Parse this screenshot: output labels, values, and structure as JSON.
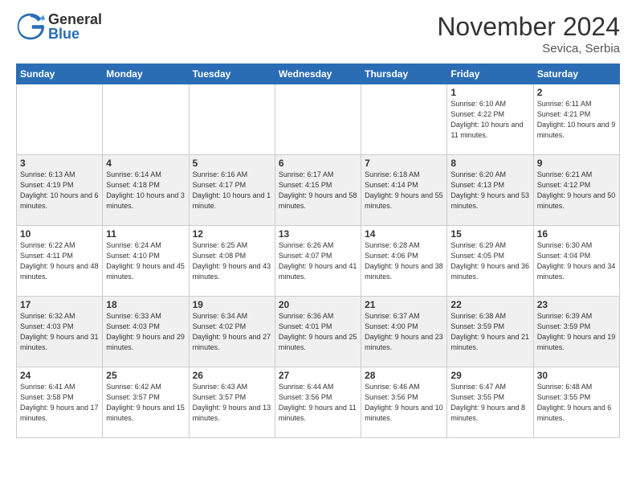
{
  "header": {
    "logo_general": "General",
    "logo_blue": "Blue",
    "month_title": "November 2024",
    "location": "Sevica, Serbia"
  },
  "days_of_week": [
    "Sunday",
    "Monday",
    "Tuesday",
    "Wednesday",
    "Thursday",
    "Friday",
    "Saturday"
  ],
  "weeks": [
    [
      {
        "day": "",
        "info": ""
      },
      {
        "day": "",
        "info": ""
      },
      {
        "day": "",
        "info": ""
      },
      {
        "day": "",
        "info": ""
      },
      {
        "day": "",
        "info": ""
      },
      {
        "day": "1",
        "info": "Sunrise: 6:10 AM\nSunset: 4:22 PM\nDaylight: 10 hours\nand 11 minutes."
      },
      {
        "day": "2",
        "info": "Sunrise: 6:11 AM\nSunset: 4:21 PM\nDaylight: 10 hours\nand 9 minutes."
      }
    ],
    [
      {
        "day": "3",
        "info": "Sunrise: 6:13 AM\nSunset: 4:19 PM\nDaylight: 10 hours\nand 6 minutes."
      },
      {
        "day": "4",
        "info": "Sunrise: 6:14 AM\nSunset: 4:18 PM\nDaylight: 10 hours\nand 3 minutes."
      },
      {
        "day": "5",
        "info": "Sunrise: 6:16 AM\nSunset: 4:17 PM\nDaylight: 10 hours\nand 1 minute."
      },
      {
        "day": "6",
        "info": "Sunrise: 6:17 AM\nSunset: 4:15 PM\nDaylight: 9 hours\nand 58 minutes."
      },
      {
        "day": "7",
        "info": "Sunrise: 6:18 AM\nSunset: 4:14 PM\nDaylight: 9 hours\nand 55 minutes."
      },
      {
        "day": "8",
        "info": "Sunrise: 6:20 AM\nSunset: 4:13 PM\nDaylight: 9 hours\nand 53 minutes."
      },
      {
        "day": "9",
        "info": "Sunrise: 6:21 AM\nSunset: 4:12 PM\nDaylight: 9 hours\nand 50 minutes."
      }
    ],
    [
      {
        "day": "10",
        "info": "Sunrise: 6:22 AM\nSunset: 4:11 PM\nDaylight: 9 hours\nand 48 minutes."
      },
      {
        "day": "11",
        "info": "Sunrise: 6:24 AM\nSunset: 4:10 PM\nDaylight: 9 hours\nand 45 minutes."
      },
      {
        "day": "12",
        "info": "Sunrise: 6:25 AM\nSunset: 4:08 PM\nDaylight: 9 hours\nand 43 minutes."
      },
      {
        "day": "13",
        "info": "Sunrise: 6:26 AM\nSunset: 4:07 PM\nDaylight: 9 hours\nand 41 minutes."
      },
      {
        "day": "14",
        "info": "Sunrise: 6:28 AM\nSunset: 4:06 PM\nDaylight: 9 hours\nand 38 minutes."
      },
      {
        "day": "15",
        "info": "Sunrise: 6:29 AM\nSunset: 4:05 PM\nDaylight: 9 hours\nand 36 minutes."
      },
      {
        "day": "16",
        "info": "Sunrise: 6:30 AM\nSunset: 4:04 PM\nDaylight: 9 hours\nand 34 minutes."
      }
    ],
    [
      {
        "day": "17",
        "info": "Sunrise: 6:32 AM\nSunset: 4:03 PM\nDaylight: 9 hours\nand 31 minutes."
      },
      {
        "day": "18",
        "info": "Sunrise: 6:33 AM\nSunset: 4:03 PM\nDaylight: 9 hours\nand 29 minutes."
      },
      {
        "day": "19",
        "info": "Sunrise: 6:34 AM\nSunset: 4:02 PM\nDaylight: 9 hours\nand 27 minutes."
      },
      {
        "day": "20",
        "info": "Sunrise: 6:36 AM\nSunset: 4:01 PM\nDaylight: 9 hours\nand 25 minutes."
      },
      {
        "day": "21",
        "info": "Sunrise: 6:37 AM\nSunset: 4:00 PM\nDaylight: 9 hours\nand 23 minutes."
      },
      {
        "day": "22",
        "info": "Sunrise: 6:38 AM\nSunset: 3:59 PM\nDaylight: 9 hours\nand 21 minutes."
      },
      {
        "day": "23",
        "info": "Sunrise: 6:39 AM\nSunset: 3:59 PM\nDaylight: 9 hours\nand 19 minutes."
      }
    ],
    [
      {
        "day": "24",
        "info": "Sunrise: 6:41 AM\nSunset: 3:58 PM\nDaylight: 9 hours\nand 17 minutes."
      },
      {
        "day": "25",
        "info": "Sunrise: 6:42 AM\nSunset: 3:57 PM\nDaylight: 9 hours\nand 15 minutes."
      },
      {
        "day": "26",
        "info": "Sunrise: 6:43 AM\nSunset: 3:57 PM\nDaylight: 9 hours\nand 13 minutes."
      },
      {
        "day": "27",
        "info": "Sunrise: 6:44 AM\nSunset: 3:56 PM\nDaylight: 9 hours\nand 11 minutes."
      },
      {
        "day": "28",
        "info": "Sunrise: 6:46 AM\nSunset: 3:56 PM\nDaylight: 9 hours\nand 10 minutes."
      },
      {
        "day": "29",
        "info": "Sunrise: 6:47 AM\nSunset: 3:55 PM\nDaylight: 9 hours\nand 8 minutes."
      },
      {
        "day": "30",
        "info": "Sunrise: 6:48 AM\nSunset: 3:55 PM\nDaylight: 9 hours\nand 6 minutes."
      }
    ]
  ]
}
